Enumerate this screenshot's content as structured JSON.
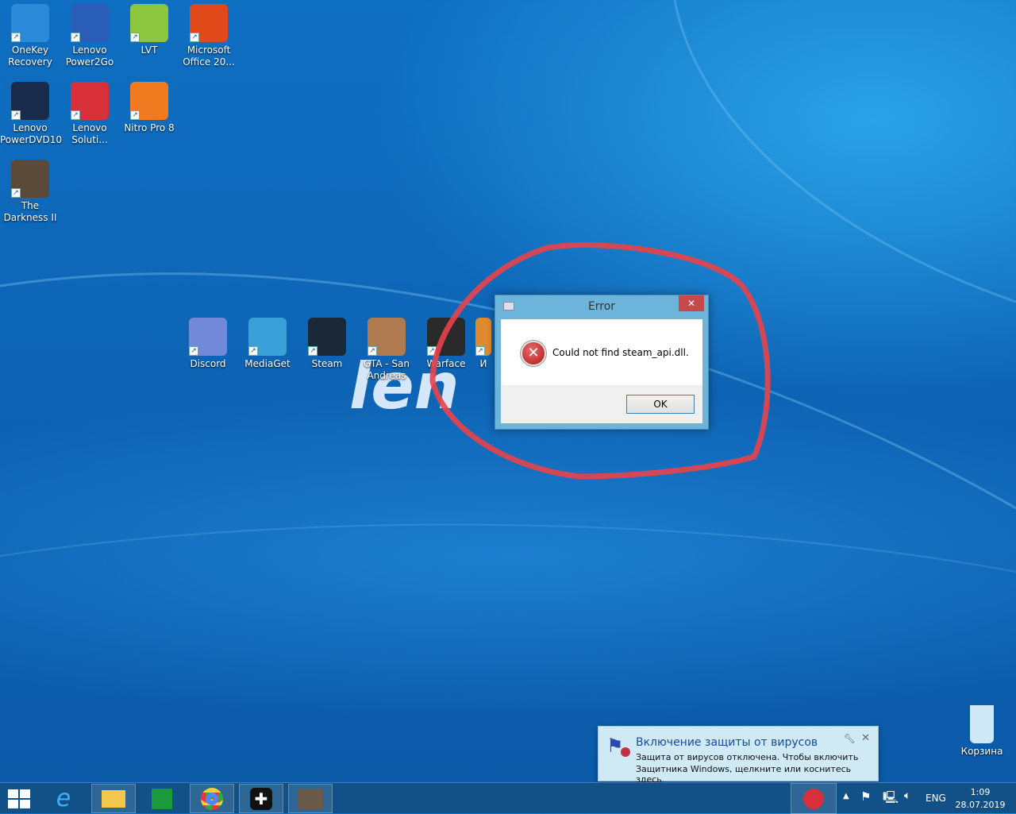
{
  "desktop_icons": [
    {
      "label": "OneKey Recovery",
      "color": "#2a8ad8"
    },
    {
      "label": "Lenovo Power2Go",
      "color": "#2a5db8"
    },
    {
      "label": "LVT",
      "color": "#8cc63f"
    },
    {
      "label": "Microsoft Office 20...",
      "color": "#e04a1a"
    },
    {
      "label": "Lenovo PowerDVD10",
      "color": "#1a2a4a"
    },
    {
      "label": "Lenovo Soluti...",
      "color": "#d8303a"
    },
    {
      "label": "Nitro Pro 8",
      "color": "#f07a20"
    },
    {
      "label": "The Darkness II",
      "color": "#5a4a3a"
    },
    {
      "label": "Discord",
      "color": "#7289da"
    },
    {
      "label": "MediaGet",
      "color": "#3aa0d8"
    },
    {
      "label": "Steam",
      "color": "#1b2838"
    },
    {
      "label": "GTA - San Andreas",
      "color": "#b07a50"
    },
    {
      "label": "Warface",
      "color": "#2a2a2a"
    },
    {
      "label": "И",
      "color": "#e08a30"
    },
    {
      "label": "Корзина",
      "color": "#cfe8f8"
    }
  ],
  "brand_watermark": "len",
  "dialog": {
    "title": "Error",
    "message": "Could not find steam_api.dll.",
    "ok_label": "OK",
    "close_glyph": "✕"
  },
  "notification": {
    "title": "Включение защиты от вирусов",
    "body_line1": "Защита от вирусов отключена. Чтобы включить",
    "body_line2": "Защитника Windows, щелкните или коснитесь здесь."
  },
  "taskbar": {
    "apps": [
      "start",
      "internet-explorer",
      "file-explorer",
      "store",
      "chrome",
      "app",
      "the-darkness-ii"
    ],
    "language": "ENG",
    "time": "1:09",
    "date": "28.07.2019"
  },
  "annotation_color": "#e8434a"
}
